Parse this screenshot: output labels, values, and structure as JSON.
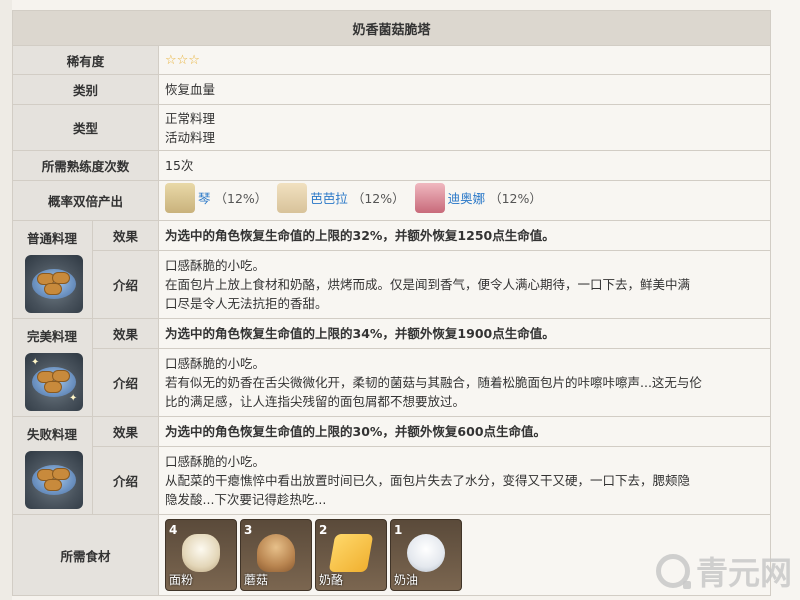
{
  "title": "奶香菌菇脆塔",
  "rows": {
    "rarity": {
      "label": "稀有度",
      "value": "☆☆☆"
    },
    "category": {
      "label": "类别",
      "value": "恢复血量"
    },
    "type": {
      "label": "类型",
      "values": [
        "正常料理",
        "活动料理"
      ]
    },
    "proficiency": {
      "label": "所需熟练度次数",
      "value": "15次"
    },
    "double": {
      "label": "概率双倍产出",
      "characters": [
        {
          "name": "琴",
          "pct": "（12%）"
        },
        {
          "name": "芭芭拉",
          "pct": "（12%）"
        },
        {
          "name": "迪奥娜",
          "pct": "（12%）"
        }
      ]
    }
  },
  "dishes": [
    {
      "name": "普通料理",
      "effect_label": "效果",
      "effect": "为选中的角色恢复生命值的上限的32%，并额外恢复1250点生命值。",
      "desc_label": "介绍",
      "desc": [
        "口感酥脆的小吃。",
        "在面包片上放上食材和奶酪，烘烤而成。仅是闻到香气，便令人满心期待，一口下去，鲜美中满",
        "口尽是令人无法抗拒的香甜。"
      ]
    },
    {
      "name": "完美料理",
      "effect_label": "效果",
      "effect": "为选中的角色恢复生命值的上限的34%，并额外恢复1900点生命值。",
      "desc_label": "介绍",
      "desc": [
        "口感酥脆的小吃。",
        "若有似无的奶香在舌尖微微化开，柔韧的菌菇与其融合，随着松脆面包片的咔嚓咔嚓声...这无与伦",
        "比的满足感，让人连指尖残留的面包屑都不想要放过。"
      ]
    },
    {
      "name": "失败料理",
      "effect_label": "效果",
      "effect": "为选中的角色恢复生命值的上限的30%，并额外恢复600点生命值。",
      "desc_label": "介绍",
      "desc": [
        "口感酥脆的小吃。",
        "从配菜的干瘪憔悴中看出放置时间已久，面包片失去了水分，变得又干又硬，一口下去，腮颊隐",
        "隐发酸...下次要记得趁热吃..."
      ]
    }
  ],
  "ingredients": {
    "label": "所需食材",
    "items": [
      {
        "count": "4",
        "name": "面粉",
        "icon": "flour-icon"
      },
      {
        "count": "3",
        "name": "蘑菇",
        "icon": "mushroom-icon"
      },
      {
        "count": "2",
        "name": "奶酪",
        "icon": "cheese-icon"
      },
      {
        "count": "1",
        "name": "奶油",
        "icon": "cream-icon"
      }
    ]
  },
  "watermark": "青元网",
  "colors": {
    "link": "#2a78c8",
    "star": "#e8b33c",
    "header_bg": "#dcd7cf"
  }
}
